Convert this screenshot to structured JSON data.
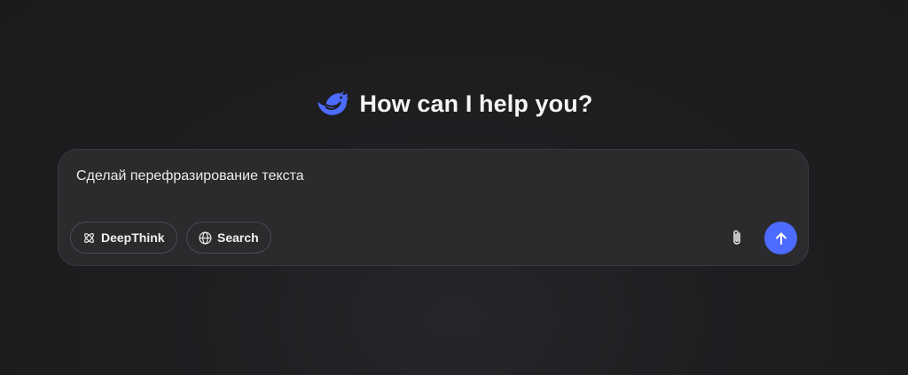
{
  "welcome": {
    "logo_icon": "deepseek-whale-icon",
    "title": "How can I help you?"
  },
  "composer": {
    "input_value": "Сделай перефразирование текста",
    "deepthink_label": "DeepThink",
    "deepthink_icon": "atom-icon",
    "search_label": "Search",
    "search_icon": "globe-icon",
    "attach_icon": "paperclip-icon",
    "send_icon": "arrow-up-icon"
  },
  "colors": {
    "background": "#1e1e21",
    "composer_background": "#2b2b2e",
    "accent": "#4d6bfe",
    "text": "#f2f2f2"
  }
}
